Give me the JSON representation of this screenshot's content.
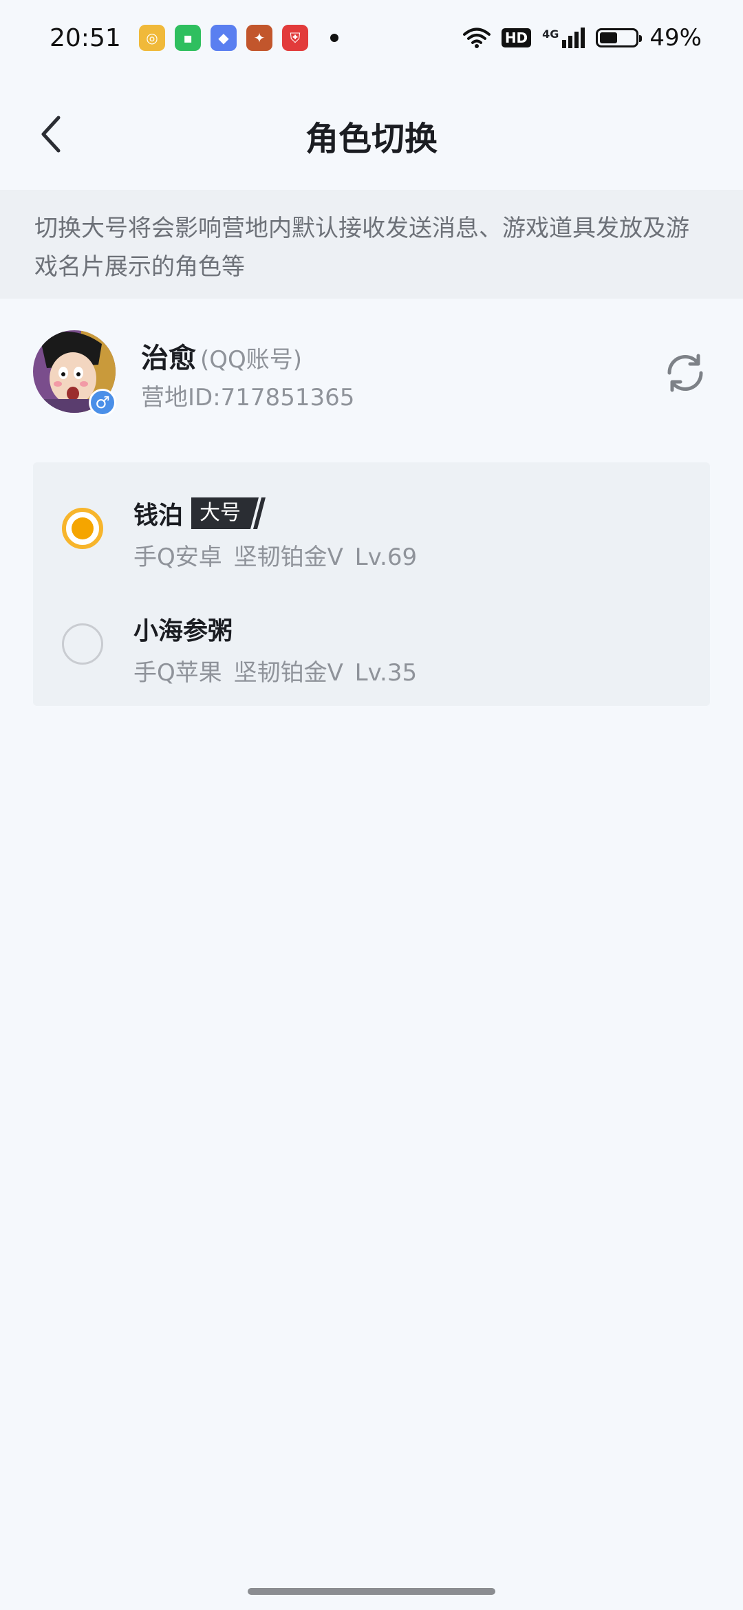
{
  "status_bar": {
    "time": "20:51",
    "hd_label": "HD",
    "network_label": "4G",
    "battery_percent": "49%",
    "battery_level": 0.49,
    "apps": [
      {
        "icon": "game-center-icon",
        "color": "#f0b93a"
      },
      {
        "icon": "chat-icon",
        "color": "#2fbf5f"
      },
      {
        "icon": "diamond-app-icon",
        "color": "#5a7ff0"
      },
      {
        "icon": "game-hero-icon",
        "color": "#c2562c"
      },
      {
        "icon": "shield-app-icon",
        "color": "#e23b3b"
      }
    ]
  },
  "header": {
    "title": "角色切换"
  },
  "notice": {
    "text": "切换大号将会影响营地内默认接收发送消息、游戏道具发放及游戏名片展示的角色等"
  },
  "account": {
    "name": "治愈",
    "type": "(QQ账号)",
    "camp_id": "营地ID:717851365",
    "gender_symbol": "♂"
  },
  "roles": [
    {
      "name": "钱泊",
      "badge": "大号",
      "meta": "手Q安卓  坚韧铂金V  Lv.69",
      "selected": true
    },
    {
      "name": "小海参粥",
      "meta": "手Q苹果  坚韧铂金V  Lv.35",
      "selected": false
    }
  ],
  "colors": {
    "accent": "#f5a500",
    "background": "#f5f8fc",
    "notice_bg": "#edf0f4",
    "list_bg": "#edf1f5",
    "badge_bg": "#2a2d33"
  }
}
